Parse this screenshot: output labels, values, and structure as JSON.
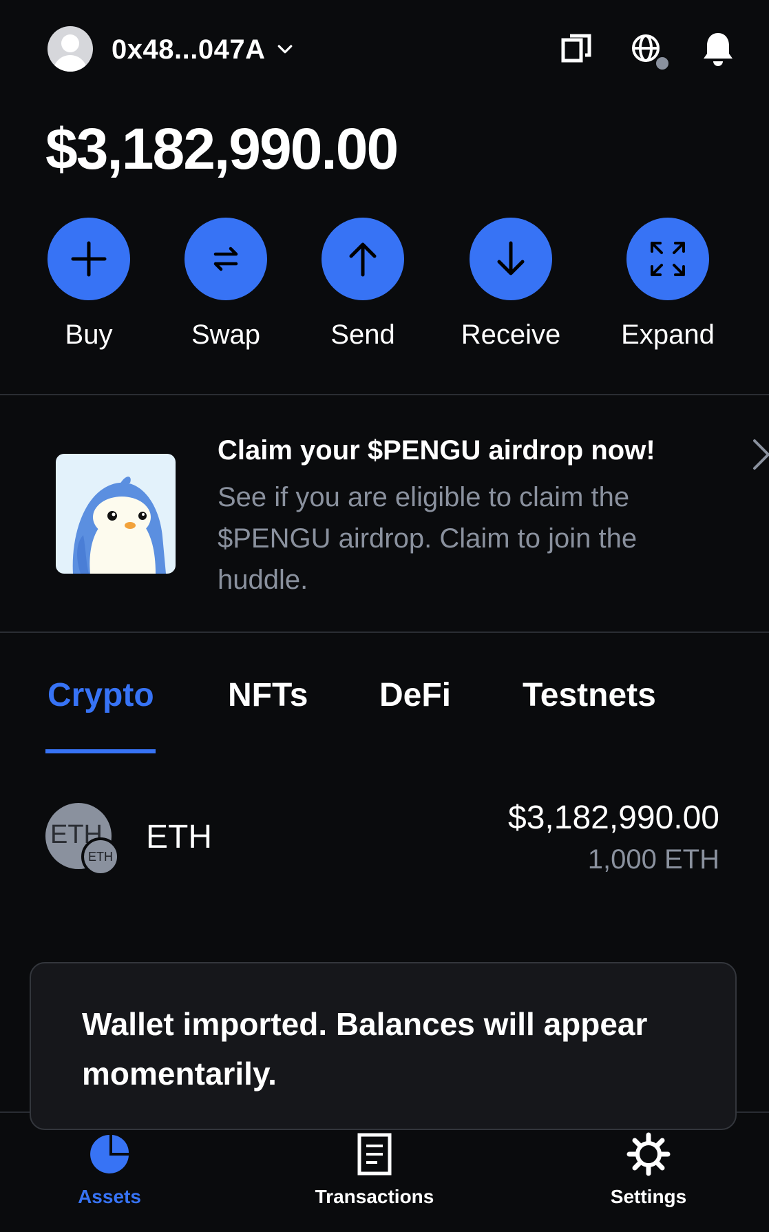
{
  "header": {
    "account_address": "0x48...047A",
    "icons": [
      "copy-icon",
      "globe-icon",
      "bell-icon"
    ]
  },
  "balance": "$3,182,990.00",
  "actions": [
    {
      "label": "Buy",
      "icon": "plus-icon"
    },
    {
      "label": "Swap",
      "icon": "swap-icon"
    },
    {
      "label": "Send",
      "icon": "arrow-up-icon"
    },
    {
      "label": "Receive",
      "icon": "arrow-down-icon"
    },
    {
      "label": "Expand",
      "icon": "expand-icon"
    }
  ],
  "promo": {
    "title": "Claim your $PENGU airdrop now!",
    "description": "See if you are eligible to claim the $PENGU airdrop. Claim to join the huddle."
  },
  "tabs": [
    {
      "label": "Crypto",
      "active": true
    },
    {
      "label": "NFTs",
      "active": false
    },
    {
      "label": "DeFi",
      "active": false
    },
    {
      "label": "Testnets",
      "active": false
    }
  ],
  "assets": [
    {
      "logo_text": "ETH",
      "badge_text": "ETH",
      "name": "ETH",
      "fiat_value": "$3,182,990.00",
      "amount": "1,000 ETH"
    }
  ],
  "toast": {
    "message": "Wallet imported. Balances will appear momentarily."
  },
  "bottom_nav": [
    {
      "label": "Assets",
      "icon": "pie-chart-icon",
      "active": true
    },
    {
      "label": "Transactions",
      "icon": "receipt-icon",
      "active": false
    },
    {
      "label": "Settings",
      "icon": "gear-icon",
      "active": false
    }
  ],
  "colors": {
    "background": "#0a0b0d",
    "accent": "#3773f5",
    "muted_text": "#8a919e",
    "toast_background": "#16171b"
  }
}
